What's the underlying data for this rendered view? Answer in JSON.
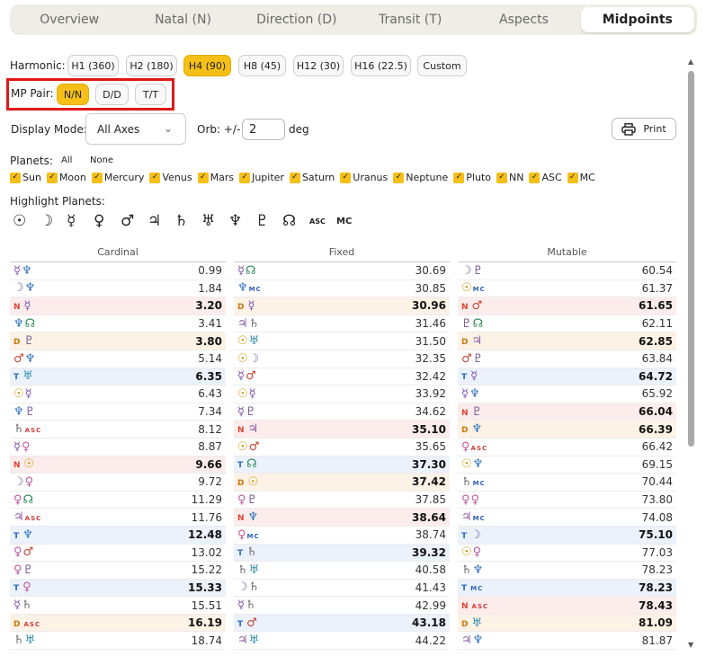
{
  "tabs": [
    "Overview",
    "Natal (N)",
    "Direction (D)",
    "Transit (T)",
    "Aspects",
    "Midpoints"
  ],
  "active_tab": "Midpoints",
  "harmonic": {
    "label": "Harmonic:",
    "options": [
      "H1 (360)",
      "H2 (180)",
      "H4 (90)",
      "H8 (45)",
      "H12 (30)",
      "H16 (22.5)",
      "Custom"
    ],
    "active": "H4 (90)"
  },
  "mp_pair": {
    "label": "MP Pair:",
    "options": [
      "N/N",
      "D/D",
      "T/T"
    ],
    "active": "N/N"
  },
  "display_mode": {
    "label": "Display Mode:",
    "value": "All Axes"
  },
  "orb": {
    "label": "Orb: +/-",
    "value": "2",
    "unit": "deg"
  },
  "print_label": "Print",
  "planets": {
    "label": "Planets:",
    "all": "All",
    "none": "None",
    "items": [
      "Sun",
      "Moon",
      "Mercury",
      "Venus",
      "Mars",
      "Jupiter",
      "Saturn",
      "Uranus",
      "Neptune",
      "Pluto",
      "NN",
      "ASC",
      "MC"
    ]
  },
  "highlight": {
    "label": "Highlight Planets:",
    "glyphs": [
      "☉",
      "☽",
      "☿",
      "♀",
      "♂",
      "♃",
      "♄",
      "♅",
      "♆",
      "♇",
      "☊",
      "ASC",
      "MC"
    ]
  },
  "columns": [
    {
      "title": "Cardinal",
      "rows": [
        {
          "p": "",
          "a": "mer",
          "b": "nep",
          "v": "0.99"
        },
        {
          "p": "",
          "a": "moon",
          "b": "nep",
          "v": "1.84"
        },
        {
          "p": "N",
          "a": "mer",
          "b": "",
          "v": "3.20"
        },
        {
          "p": "",
          "a": "nep",
          "b": "nn",
          "v": "3.41"
        },
        {
          "p": "D",
          "a": "plu",
          "b": "",
          "v": "3.80"
        },
        {
          "p": "",
          "a": "mar",
          "b": "nep",
          "v": "5.14"
        },
        {
          "p": "T",
          "a": "ura",
          "b": "",
          "v": "6.35"
        },
        {
          "p": "",
          "a": "sun",
          "b": "mer",
          "v": "6.43"
        },
        {
          "p": "",
          "a": "nep",
          "b": "plu",
          "v": "7.34"
        },
        {
          "p": "",
          "a": "sat",
          "b": "asc",
          "v": "8.12"
        },
        {
          "p": "",
          "a": "mer",
          "b": "ven",
          "v": "8.87"
        },
        {
          "p": "N",
          "a": "sun",
          "b": "",
          "v": "9.66"
        },
        {
          "p": "",
          "a": "moon",
          "b": "ven",
          "v": "9.72"
        },
        {
          "p": "",
          "a": "ven",
          "b": "nn",
          "v": "11.29"
        },
        {
          "p": "",
          "a": "jup",
          "b": "asc",
          "v": "11.76"
        },
        {
          "p": "T",
          "a": "nep",
          "b": "",
          "v": "12.48"
        },
        {
          "p": "",
          "a": "ven",
          "b": "mar",
          "v": "13.02"
        },
        {
          "p": "",
          "a": "ven",
          "b": "plu",
          "v": "15.22"
        },
        {
          "p": "T",
          "a": "ven",
          "b": "",
          "v": "15.33"
        },
        {
          "p": "",
          "a": "mer",
          "b": "sat",
          "v": "15.51"
        },
        {
          "p": "D",
          "a": "asc",
          "b": "",
          "v": "16.19"
        },
        {
          "p": "",
          "a": "sat",
          "b": "ura",
          "v": "18.74"
        }
      ]
    },
    {
      "title": "Fixed",
      "rows": [
        {
          "p": "",
          "a": "mer",
          "b": "nn",
          "v": "30.69"
        },
        {
          "p": "",
          "a": "nep",
          "b": "mc",
          "v": "30.85"
        },
        {
          "p": "D",
          "a": "mer",
          "b": "",
          "v": "30.96"
        },
        {
          "p": "",
          "a": "jup",
          "b": "sat",
          "v": "31.46"
        },
        {
          "p": "",
          "a": "sun",
          "b": "ura",
          "v": "31.50"
        },
        {
          "p": "",
          "a": "sun",
          "b": "moon",
          "v": "32.35"
        },
        {
          "p": "",
          "a": "mer",
          "b": "mar",
          "v": "32.42"
        },
        {
          "p": "",
          "a": "sun",
          "b": "mer",
          "v": "33.92"
        },
        {
          "p": "",
          "a": "mer",
          "b": "plu",
          "v": "34.62"
        },
        {
          "p": "N",
          "a": "jup",
          "b": "",
          "v": "35.10"
        },
        {
          "p": "",
          "a": "sun",
          "b": "mar",
          "v": "35.65"
        },
        {
          "p": "T",
          "a": "nn",
          "b": "",
          "v": "37.30"
        },
        {
          "p": "D",
          "a": "sun",
          "b": "",
          "v": "37.42"
        },
        {
          "p": "",
          "a": "ven",
          "b": "plu",
          "v": "37.85"
        },
        {
          "p": "N",
          "a": "nep",
          "b": "",
          "v": "38.64"
        },
        {
          "p": "",
          "a": "ven",
          "b": "mc",
          "v": "38.74"
        },
        {
          "p": "T",
          "a": "sat",
          "b": "",
          "v": "39.32"
        },
        {
          "p": "",
          "a": "sat",
          "b": "ura",
          "v": "40.58"
        },
        {
          "p": "",
          "a": "moon",
          "b": "sat",
          "v": "41.43"
        },
        {
          "p": "",
          "a": "mer",
          "b": "sat",
          "v": "42.99"
        },
        {
          "p": "T",
          "a": "mar",
          "b": "",
          "v": "43.18"
        },
        {
          "p": "",
          "a": "jup",
          "b": "ura",
          "v": "44.22"
        }
      ]
    },
    {
      "title": "Mutable",
      "rows": [
        {
          "p": "",
          "a": "moon",
          "b": "plu",
          "v": "60.54"
        },
        {
          "p": "",
          "a": "sun",
          "b": "mc",
          "v": "61.37"
        },
        {
          "p": "N",
          "a": "mar",
          "b": "",
          "v": "61.65"
        },
        {
          "p": "",
          "a": "plu",
          "b": "nn",
          "v": "62.11"
        },
        {
          "p": "D",
          "a": "jup",
          "b": "",
          "v": "62.85"
        },
        {
          "p": "",
          "a": "mar",
          "b": "plu",
          "v": "63.84"
        },
        {
          "p": "T",
          "a": "mer",
          "b": "",
          "v": "64.72"
        },
        {
          "p": "",
          "a": "mer",
          "b": "nep",
          "v": "65.92"
        },
        {
          "p": "N",
          "a": "plu",
          "b": "",
          "v": "66.04"
        },
        {
          "p": "D",
          "a": "nep",
          "b": "",
          "v": "66.39"
        },
        {
          "p": "",
          "a": "ven",
          "b": "asc",
          "v": "66.42"
        },
        {
          "p": "",
          "a": "sun",
          "b": "nep",
          "v": "69.15"
        },
        {
          "p": "",
          "a": "sat",
          "b": "mc",
          "v": "70.44"
        },
        {
          "p": "",
          "a": "ven",
          "b": "ven",
          "v": "73.80"
        },
        {
          "p": "",
          "a": "jup",
          "b": "mc",
          "v": "74.08"
        },
        {
          "p": "T",
          "a": "moon",
          "b": "",
          "v": "75.10"
        },
        {
          "p": "",
          "a": "sun",
          "b": "ven",
          "v": "77.03"
        },
        {
          "p": "",
          "a": "sat",
          "b": "nep",
          "v": "78.23"
        },
        {
          "p": "T",
          "a": "mc",
          "b": "",
          "v": "78.23"
        },
        {
          "p": "N",
          "a": "asc",
          "b": "",
          "v": "78.43"
        },
        {
          "p": "D",
          "a": "ura",
          "b": "",
          "v": "81.09"
        },
        {
          "p": "",
          "a": "jup",
          "b": "nep",
          "v": "81.87"
        }
      ]
    }
  ]
}
